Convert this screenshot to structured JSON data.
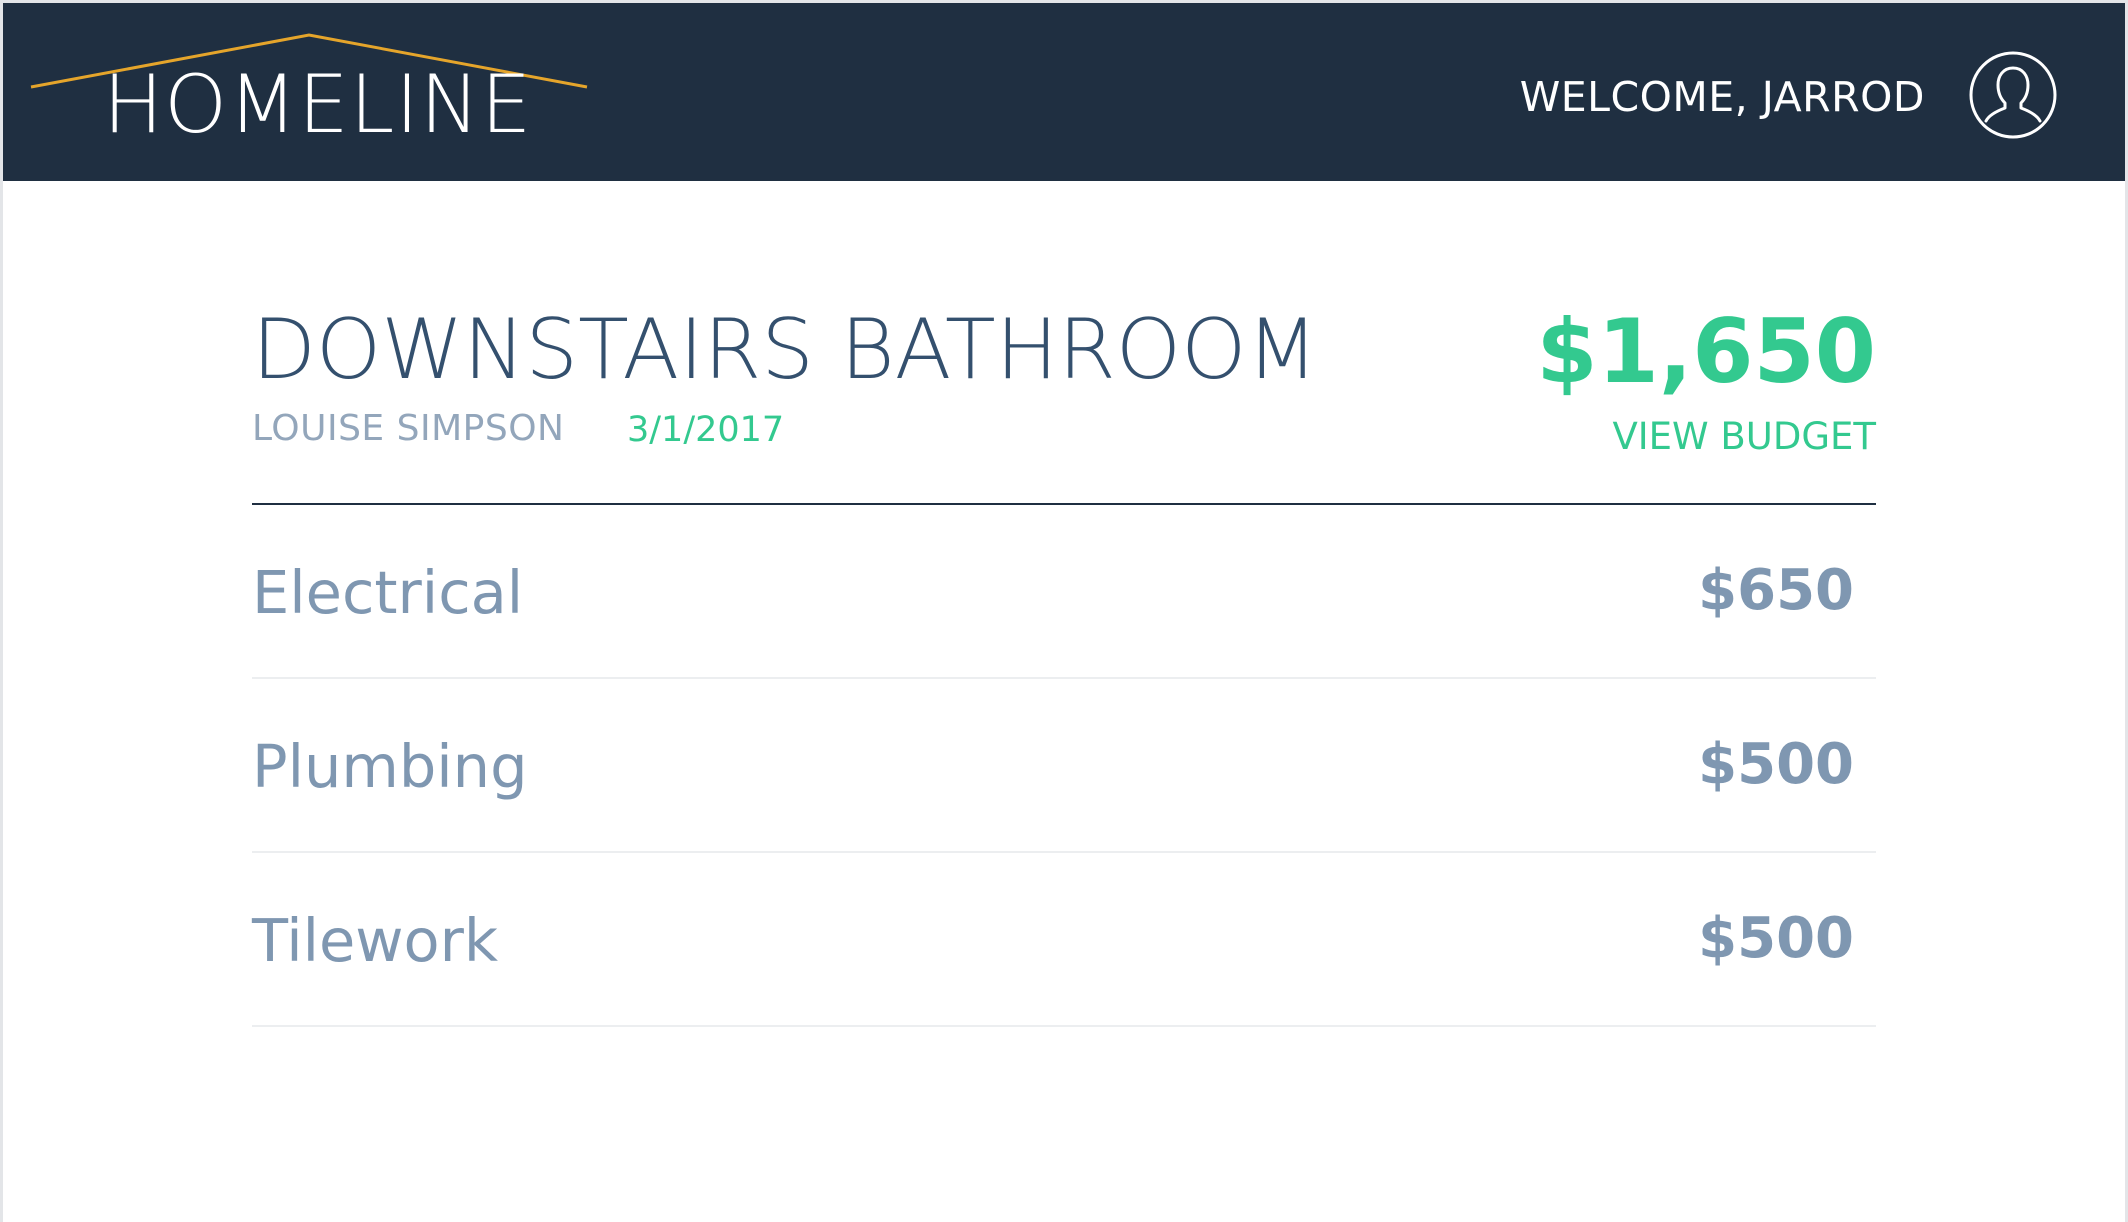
{
  "header": {
    "logo_text": "HOMELINE",
    "welcome_text": "WELCOME, JARROD",
    "avatar_icon": "user-avatar-icon",
    "background_color": "#1f2f41",
    "roof_color": "#e5a52b"
  },
  "project": {
    "title": "DOWNSTAIRS BATHROOM",
    "owner": "LOUISE SIMPSON",
    "date": "3/1/2017",
    "total": "$1,650",
    "view_budget_label": "VIEW BUDGET"
  },
  "line_items": [
    {
      "name": "Electrical",
      "amount": "$650"
    },
    {
      "name": "Plumbing",
      "amount": "$500"
    },
    {
      "name": "Tilework",
      "amount": "$500"
    }
  ],
  "colors": {
    "accent_green": "#33c98f",
    "title_blue": "#34506e",
    "muted_text": "#7f97b1"
  }
}
